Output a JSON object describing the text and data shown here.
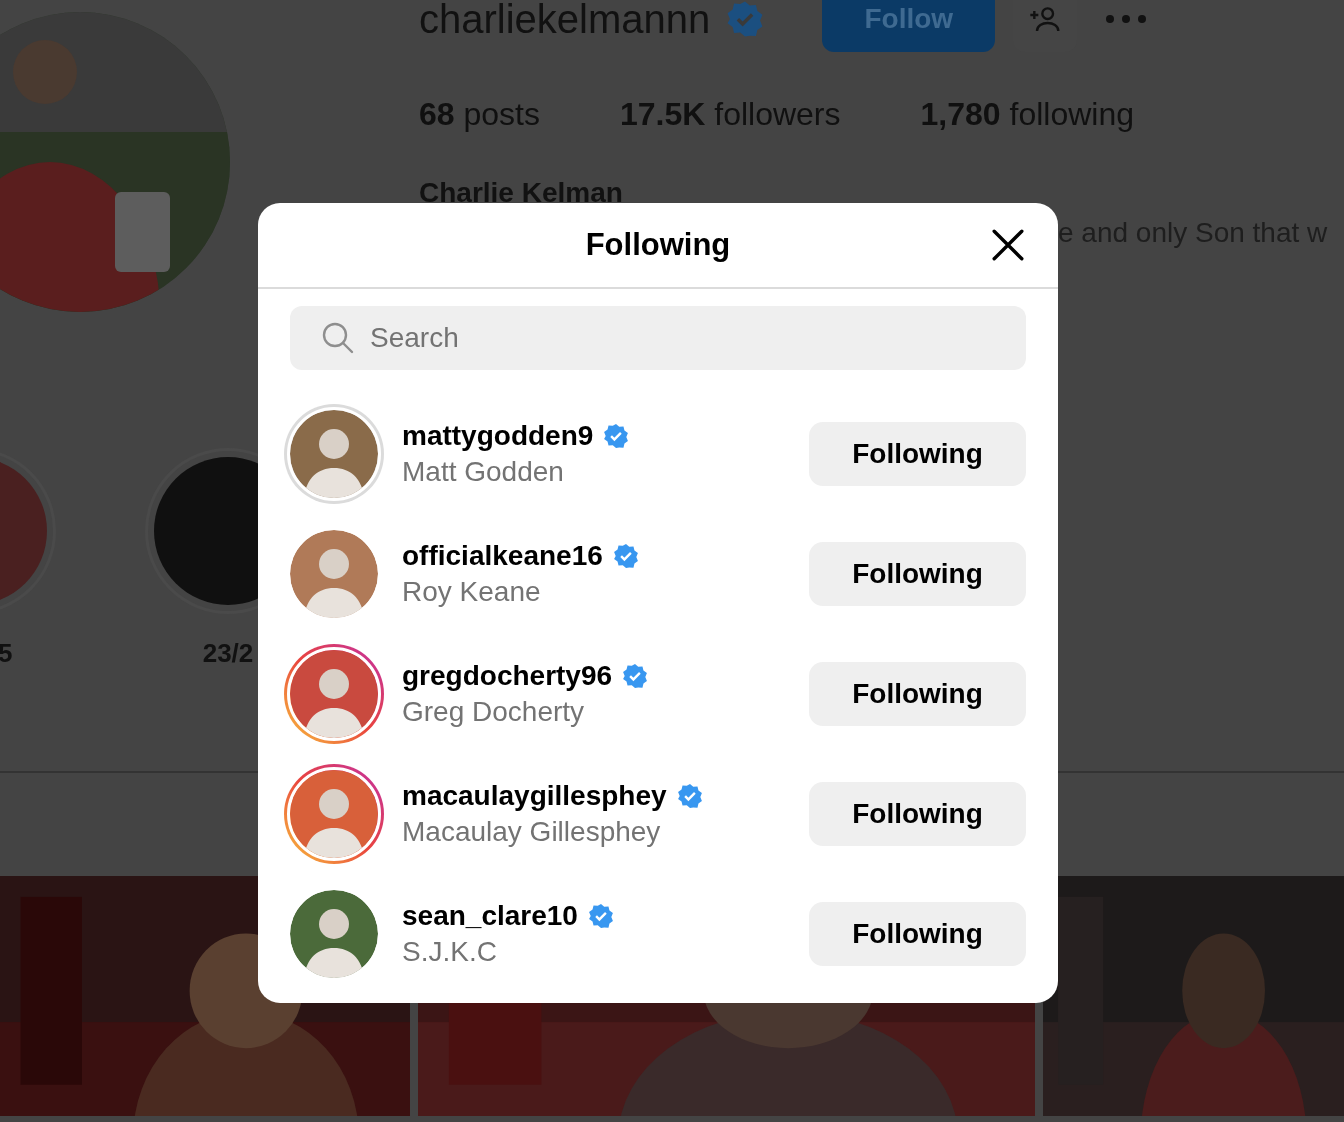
{
  "profile": {
    "username": "charliekelmannn",
    "verified": true,
    "follow_button": "Follow",
    "stats": [
      "**68** posts",
      "**17.5K** followers",
      "**1,780** following"
    ],
    "name": "Charlie Kelman",
    "bio": "e and only Son that w"
  },
  "highlights": [
    {
      "label": "5"
    },
    {
      "label": "23/2"
    }
  ],
  "modal": {
    "title": "Following",
    "search": {
      "placeholder": "Search"
    },
    "accounts": [
      {
        "username": "mattygodden9",
        "name": "Matt Godden",
        "verified": true,
        "has_story": true,
        "story_viewed": true,
        "button": "Following"
      },
      {
        "username": "officialkeane16",
        "name": "Roy Keane",
        "verified": true,
        "has_story": false,
        "story_viewed": false,
        "button": "Following"
      },
      {
        "username": "gregdocherty96",
        "name": "Greg Docherty",
        "verified": true,
        "has_story": true,
        "story_viewed": false,
        "button": "Following"
      },
      {
        "username": "macaulaygillesphey",
        "name": "Macaulay Gillesphey",
        "verified": true,
        "has_story": true,
        "story_viewed": false,
        "button": "Following"
      },
      {
        "username": "sean_clare10",
        "name": "S.J.K.C",
        "verified": true,
        "has_story": false,
        "story_viewed": false,
        "button": "Following"
      }
    ]
  }
}
